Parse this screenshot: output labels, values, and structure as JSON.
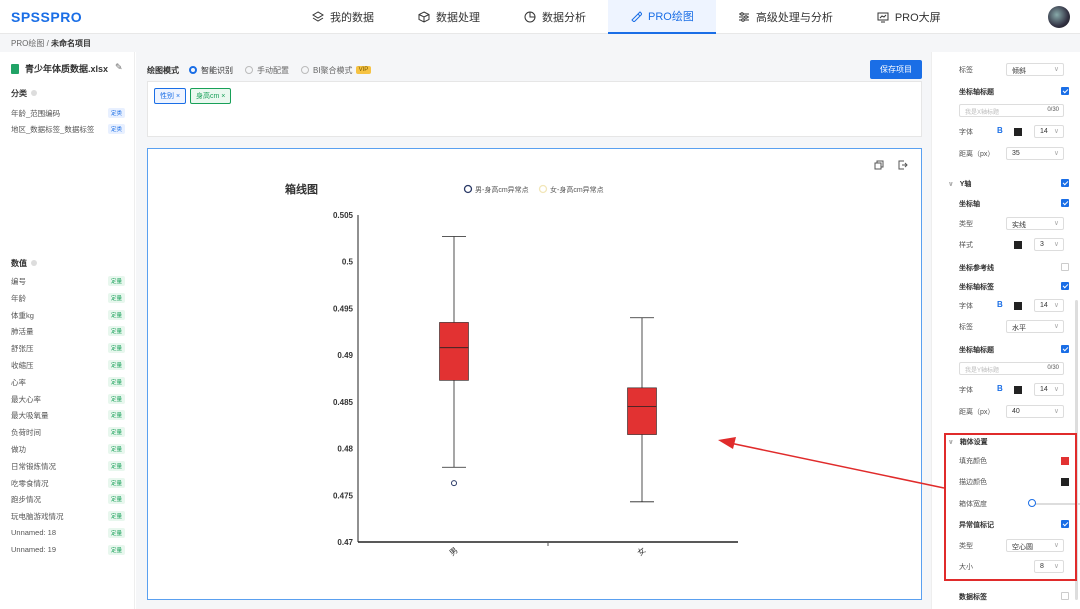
{
  "app": {
    "logo": "SPSSPRO"
  },
  "nav": [
    {
      "label": "我的数据",
      "icon": "layers-icon"
    },
    {
      "label": "数据处理",
      "icon": "cube-icon"
    },
    {
      "label": "数据分析",
      "icon": "pie-icon"
    },
    {
      "label": "PRO绘图",
      "icon": "brush-icon",
      "active": true
    },
    {
      "label": "高级处理与分析",
      "icon": "sliders-icon"
    },
    {
      "label": "PRO大屏",
      "icon": "monitor-icon"
    }
  ],
  "breadcrumb": {
    "root": "PRO绘图",
    "sep": " / ",
    "current": "未命名项目"
  },
  "left": {
    "file_name": "青少年体质数据.xlsx",
    "category_title": "分类",
    "category_vars": [
      {
        "name": "年龄_范围编码",
        "tag": "定类"
      },
      {
        "name": "地区_数据标签_数据标签",
        "tag": "定类"
      }
    ],
    "numeric_title": "数值",
    "numeric_vars": [
      {
        "name": "编号",
        "tag": "定量"
      },
      {
        "name": "年龄",
        "tag": "定量"
      },
      {
        "name": "体重kg",
        "tag": "定量"
      },
      {
        "name": "肺活量",
        "tag": "定量"
      },
      {
        "name": "舒张压",
        "tag": "定量"
      },
      {
        "name": "收缩压",
        "tag": "定量"
      },
      {
        "name": "心率",
        "tag": "定量"
      },
      {
        "name": "最大心率",
        "tag": "定量"
      },
      {
        "name": "最大吸氧量",
        "tag": "定量"
      },
      {
        "name": "负荷时间",
        "tag": "定量"
      },
      {
        "name": "做功",
        "tag": "定量"
      },
      {
        "name": "日常锻炼情况",
        "tag": "定量"
      },
      {
        "name": "吃零食情况",
        "tag": "定量"
      },
      {
        "name": "跑步情况",
        "tag": "定量"
      },
      {
        "name": "玩电脑游戏情况",
        "tag": "定量"
      },
      {
        "name": "Unnamed: 18",
        "tag": "定量"
      },
      {
        "name": "Unnamed: 19",
        "tag": "定量"
      }
    ]
  },
  "toolbar": {
    "mode_label": "绘图模式",
    "modes": [
      "智能识别",
      "手动配置",
      "BI聚合模式"
    ],
    "vip": "VIP",
    "save_label": "保存项目"
  },
  "chips": [
    "性别",
    "身高cm"
  ],
  "canvas_icons": [
    "copy-icon",
    "export-icon"
  ],
  "chart_data": {
    "type": "box",
    "title": "箱线图",
    "legend": [
      "男-身高cm异常点",
      "女-身高cm异常点"
    ],
    "categories": [
      "男",
      "女"
    ],
    "ylim": [
      0.47,
      0.505
    ],
    "yticks": [
      "0.505",
      "0.5",
      "0.495",
      "0.49",
      "0.485",
      "0.48",
      "0.475",
      "0.47"
    ],
    "boxes": [
      {
        "category": "男",
        "min": 0.478,
        "q1": 0.4873,
        "median": 0.4908,
        "q3": 0.4935,
        "max": 0.5027,
        "outliers": [
          0.4763
        ]
      },
      {
        "category": "女",
        "min": 0.4743,
        "q1": 0.4815,
        "median": 0.4845,
        "q3": 0.4865,
        "max": 0.494,
        "outliers": []
      }
    ],
    "fill_color": "#e23232",
    "stroke_color": "#222222",
    "legend_colors": [
      "#2b3a67",
      "#f2e6b8"
    ]
  },
  "right": {
    "x_label_row": {
      "label": "标签",
      "value": "倾斜"
    },
    "x_axis_title": {
      "label": "坐标轴标题",
      "placeholder": "我是X轴标题",
      "count": "0/30"
    },
    "x_font": {
      "label": "字体",
      "bold": "B",
      "size": "14"
    },
    "x_distance": {
      "label": "距离（px）",
      "value": "35"
    },
    "y_axis": {
      "label": "Y轴"
    },
    "y_coord": {
      "label": "坐标轴"
    },
    "y_type": {
      "label": "类型",
      "value": "实线"
    },
    "y_style": {
      "label": "样式",
      "value": "3"
    },
    "y_ref": {
      "label": "坐标参考线"
    },
    "y_tick_label": {
      "label": "坐标轴标签"
    },
    "y_font": {
      "label": "字体",
      "bold": "B",
      "size": "14"
    },
    "y_label_dir": {
      "label": "标签",
      "value": "水平"
    },
    "y_axis_title": {
      "label": "坐标轴标题",
      "placeholder": "我是Y轴标题",
      "count": "0/30"
    },
    "y_font2": {
      "label": "字体",
      "bold": "B",
      "size": "14"
    },
    "y_distance": {
      "label": "距离（px）",
      "value": "40"
    },
    "box_settings": {
      "label": "箱体设置"
    },
    "fill_color": {
      "label": "填充颜色"
    },
    "stroke_color": {
      "label": "描边颜色"
    },
    "box_width": {
      "label": "箱体宽度"
    },
    "outlier": {
      "label": "异常值标记"
    },
    "outlier_type": {
      "label": "类型",
      "value": "空心圆"
    },
    "outlier_size": {
      "label": "大小",
      "value": "8"
    },
    "data_label": {
      "label": "数据标签"
    }
  }
}
